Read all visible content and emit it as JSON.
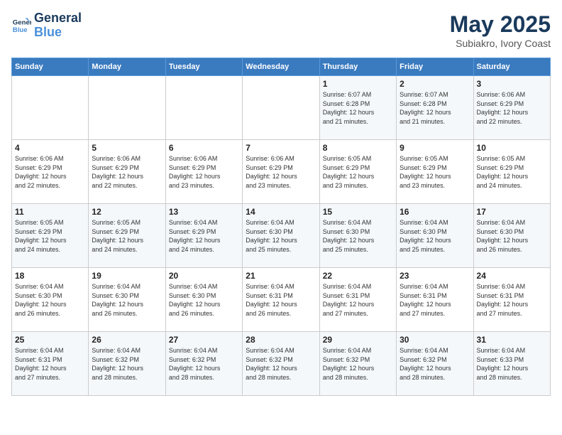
{
  "header": {
    "logo_line1": "General",
    "logo_line2": "Blue",
    "title": "May 2025",
    "subtitle": "Subiakro, Ivory Coast"
  },
  "weekdays": [
    "Sunday",
    "Monday",
    "Tuesday",
    "Wednesday",
    "Thursday",
    "Friday",
    "Saturday"
  ],
  "weeks": [
    [
      {
        "day": "",
        "info": ""
      },
      {
        "day": "",
        "info": ""
      },
      {
        "day": "",
        "info": ""
      },
      {
        "day": "",
        "info": ""
      },
      {
        "day": "1",
        "info": "Sunrise: 6:07 AM\nSunset: 6:28 PM\nDaylight: 12 hours\nand 21 minutes."
      },
      {
        "day": "2",
        "info": "Sunrise: 6:07 AM\nSunset: 6:28 PM\nDaylight: 12 hours\nand 21 minutes."
      },
      {
        "day": "3",
        "info": "Sunrise: 6:06 AM\nSunset: 6:29 PM\nDaylight: 12 hours\nand 22 minutes."
      }
    ],
    [
      {
        "day": "4",
        "info": "Sunrise: 6:06 AM\nSunset: 6:29 PM\nDaylight: 12 hours\nand 22 minutes."
      },
      {
        "day": "5",
        "info": "Sunrise: 6:06 AM\nSunset: 6:29 PM\nDaylight: 12 hours\nand 22 minutes."
      },
      {
        "day": "6",
        "info": "Sunrise: 6:06 AM\nSunset: 6:29 PM\nDaylight: 12 hours\nand 23 minutes."
      },
      {
        "day": "7",
        "info": "Sunrise: 6:06 AM\nSunset: 6:29 PM\nDaylight: 12 hours\nand 23 minutes."
      },
      {
        "day": "8",
        "info": "Sunrise: 6:05 AM\nSunset: 6:29 PM\nDaylight: 12 hours\nand 23 minutes."
      },
      {
        "day": "9",
        "info": "Sunrise: 6:05 AM\nSunset: 6:29 PM\nDaylight: 12 hours\nand 23 minutes."
      },
      {
        "day": "10",
        "info": "Sunrise: 6:05 AM\nSunset: 6:29 PM\nDaylight: 12 hours\nand 24 minutes."
      }
    ],
    [
      {
        "day": "11",
        "info": "Sunrise: 6:05 AM\nSunset: 6:29 PM\nDaylight: 12 hours\nand 24 minutes."
      },
      {
        "day": "12",
        "info": "Sunrise: 6:05 AM\nSunset: 6:29 PM\nDaylight: 12 hours\nand 24 minutes."
      },
      {
        "day": "13",
        "info": "Sunrise: 6:04 AM\nSunset: 6:29 PM\nDaylight: 12 hours\nand 24 minutes."
      },
      {
        "day": "14",
        "info": "Sunrise: 6:04 AM\nSunset: 6:30 PM\nDaylight: 12 hours\nand 25 minutes."
      },
      {
        "day": "15",
        "info": "Sunrise: 6:04 AM\nSunset: 6:30 PM\nDaylight: 12 hours\nand 25 minutes."
      },
      {
        "day": "16",
        "info": "Sunrise: 6:04 AM\nSunset: 6:30 PM\nDaylight: 12 hours\nand 25 minutes."
      },
      {
        "day": "17",
        "info": "Sunrise: 6:04 AM\nSunset: 6:30 PM\nDaylight: 12 hours\nand 26 minutes."
      }
    ],
    [
      {
        "day": "18",
        "info": "Sunrise: 6:04 AM\nSunset: 6:30 PM\nDaylight: 12 hours\nand 26 minutes."
      },
      {
        "day": "19",
        "info": "Sunrise: 6:04 AM\nSunset: 6:30 PM\nDaylight: 12 hours\nand 26 minutes."
      },
      {
        "day": "20",
        "info": "Sunrise: 6:04 AM\nSunset: 6:30 PM\nDaylight: 12 hours\nand 26 minutes."
      },
      {
        "day": "21",
        "info": "Sunrise: 6:04 AM\nSunset: 6:31 PM\nDaylight: 12 hours\nand 26 minutes."
      },
      {
        "day": "22",
        "info": "Sunrise: 6:04 AM\nSunset: 6:31 PM\nDaylight: 12 hours\nand 27 minutes."
      },
      {
        "day": "23",
        "info": "Sunrise: 6:04 AM\nSunset: 6:31 PM\nDaylight: 12 hours\nand 27 minutes."
      },
      {
        "day": "24",
        "info": "Sunrise: 6:04 AM\nSunset: 6:31 PM\nDaylight: 12 hours\nand 27 minutes."
      }
    ],
    [
      {
        "day": "25",
        "info": "Sunrise: 6:04 AM\nSunset: 6:31 PM\nDaylight: 12 hours\nand 27 minutes."
      },
      {
        "day": "26",
        "info": "Sunrise: 6:04 AM\nSunset: 6:32 PM\nDaylight: 12 hours\nand 28 minutes."
      },
      {
        "day": "27",
        "info": "Sunrise: 6:04 AM\nSunset: 6:32 PM\nDaylight: 12 hours\nand 28 minutes."
      },
      {
        "day": "28",
        "info": "Sunrise: 6:04 AM\nSunset: 6:32 PM\nDaylight: 12 hours\nand 28 minutes."
      },
      {
        "day": "29",
        "info": "Sunrise: 6:04 AM\nSunset: 6:32 PM\nDaylight: 12 hours\nand 28 minutes."
      },
      {
        "day": "30",
        "info": "Sunrise: 6:04 AM\nSunset: 6:32 PM\nDaylight: 12 hours\nand 28 minutes."
      },
      {
        "day": "31",
        "info": "Sunrise: 6:04 AM\nSunset: 6:33 PM\nDaylight: 12 hours\nand 28 minutes."
      }
    ]
  ]
}
